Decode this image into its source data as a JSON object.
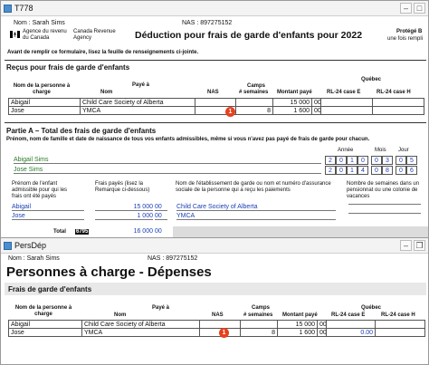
{
  "window1": {
    "title": "T778",
    "name_label": "Nom : Sarah Sims",
    "nas_label": "NAS : 897275152",
    "agency_fr": "Agence du revenu du Canada",
    "agency_en": "Canada Revenue Agency",
    "form_title": "Déduction pour frais de garde d'enfants pour 2022",
    "protected": "Protégé B",
    "protected_sub": "une fois rempli",
    "instruction": "Avant de remplir ce formulaire, lisez la feuille de renseignements ci-jointe.",
    "section1_title": "Reçus pour frais de garde d'enfants",
    "quebec_label": "Québec",
    "headers": {
      "dependent": "Nom de la personne à charge",
      "paid_to": "Payé à",
      "name": "Nom",
      "nas": "NAS",
      "camps": "Camps",
      "weeks": "# semaines",
      "amount": "Montant payé",
      "rl24e": "RL-24 case E",
      "rl24h": "RL-24 case H"
    },
    "rows": [
      {
        "dependent": "Abigail",
        "paid_to": "Child Care Society of Alberta",
        "nas": "",
        "weeks": "",
        "amount": "15 000",
        "cents": "00"
      },
      {
        "dependent": "Jose",
        "paid_to": "YMCA",
        "nas": "",
        "weeks": "8",
        "amount": "1 600",
        "cents": "00"
      }
    ],
    "partA_title": "Partie A – Total des frais de garde d'enfants",
    "partA_desc": "Prénom, nom de famille et date de naissance de tous vos enfants admissibles, même si vous n'avez pas payé de frais de garde pour chacun.",
    "date_headers": {
      "year": "Année",
      "month": "Mois",
      "day": "Jour"
    },
    "children": [
      {
        "name": "Abigail Sims",
        "digits": [
          "2",
          "0",
          "1",
          "0",
          "0",
          "3",
          "0",
          "5"
        ]
      },
      {
        "name": "Jose Sims",
        "digits": [
          "2",
          "0",
          "1",
          "4",
          "0",
          "8",
          "0",
          "6"
        ]
      }
    ],
    "partA_cols": {
      "child_first_name": "Prénom de l'enfant admissible pour qui les frais ont été payés",
      "fees_paid": "Frais payés (lisez la Remarque ci-dessous)",
      "provider": "Nom de l'établissement de garde ou nom et numéro d'assurance sociale de la personne qui a reçu les paiements",
      "weeks": "Nombre de semaines dans un pensionnat ou une colonie de vacances"
    },
    "partA_rows": [
      {
        "child": "Abigail",
        "fees": "15 000",
        "cents": "00",
        "provider": "Child Care Society of Alberta"
      },
      {
        "child": "Jose",
        "fees": "1 000",
        "cents": "00",
        "provider": "YMCA"
      }
    ],
    "total_label": "Total",
    "total_code": "6795",
    "total_amount": "16 000",
    "total_cents": "00",
    "marker": "1"
  },
  "window2": {
    "title": "PersDép",
    "name_label": "Nom : Sarah Sims",
    "nas_label": "NAS : 897275152",
    "heading": "Personnes à charge - Dépenses",
    "section_title": "Frais de garde d'enfants",
    "quebec_label": "Québec",
    "headers": {
      "dependent": "Nom de la personne à charge",
      "paid_to": "Payé à",
      "name": "Nom",
      "nas": "NAS",
      "camps": "Camps",
      "weeks": "# semaines",
      "amount": "Montant payé",
      "rl24e": "RL-24 case E",
      "rl24h": "RL-24 case H"
    },
    "rows": [
      {
        "dependent": "Abigail",
        "paid_to": "Child Care Society of Alberta",
        "nas": "",
        "weeks": "",
        "amount": "15 000",
        "cents": "00",
        "rl24e": ""
      },
      {
        "dependent": "Jose",
        "paid_to": "YMCA",
        "nas": "",
        "weeks": "8",
        "amount": "1 600",
        "cents": "00",
        "rl24e": "0.00"
      }
    ],
    "marker": "1"
  },
  "colors": {
    "marker": "#e8401c",
    "link_blue": "#1a3fb5",
    "name_green": "#2a7a2a"
  },
  "icons": [
    "canada-flag-icon",
    "minimize-icon",
    "maximize-icon",
    "restore-icon"
  ]
}
